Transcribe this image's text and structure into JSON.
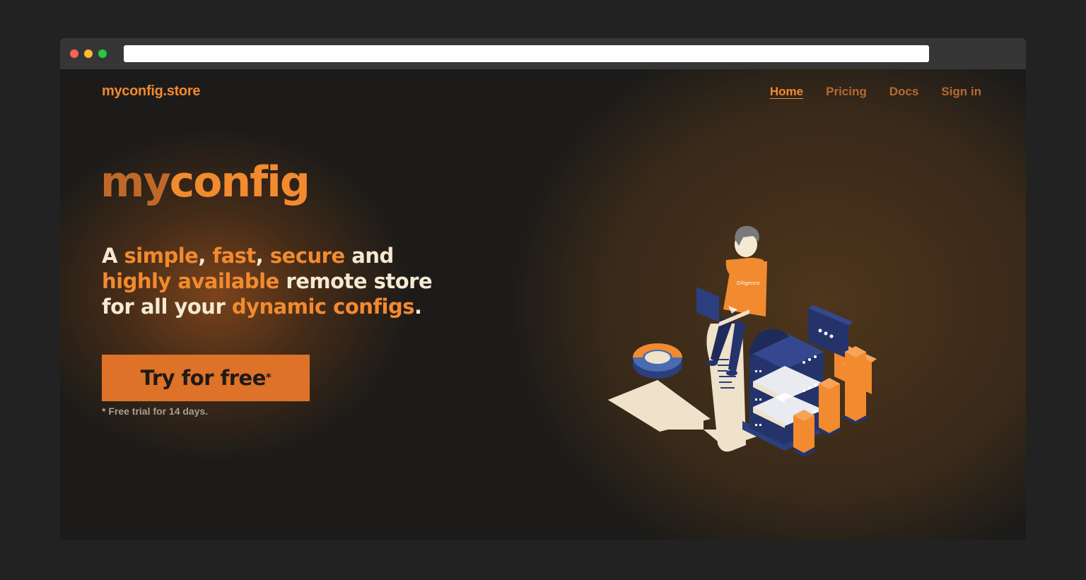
{
  "browser": {
    "url_bar_value": ""
  },
  "header": {
    "brand": "myconfig.store",
    "nav": [
      {
        "label": "Home",
        "active": true
      },
      {
        "label": "Pricing",
        "active": false
      },
      {
        "label": "Docs",
        "active": false
      },
      {
        "label": "Sign in",
        "active": false
      }
    ]
  },
  "hero": {
    "title_part1": "my",
    "title_part2": "config",
    "tagline": {
      "t1": "A ",
      "h1": "simple",
      "t2": ", ",
      "h2": "fast",
      "t3": ", ",
      "h3": "secure",
      "t4": " and ",
      "h4": "highly available",
      "t5": " remote store for all your ",
      "h5": "dynamic configs",
      "t6": "."
    },
    "cta_label": "Try for free",
    "cta_mark": "*",
    "note": "* Free trial for 14 days."
  },
  "illustration": {
    "shirt_text": "Diligence"
  },
  "colors": {
    "accent": "#f28a2f",
    "accent_dark": "#c0682a",
    "cta_bg": "#dd7228",
    "background": "#1c1b19",
    "tagline_text": "#f5e9d2",
    "navy": "#24346b"
  }
}
